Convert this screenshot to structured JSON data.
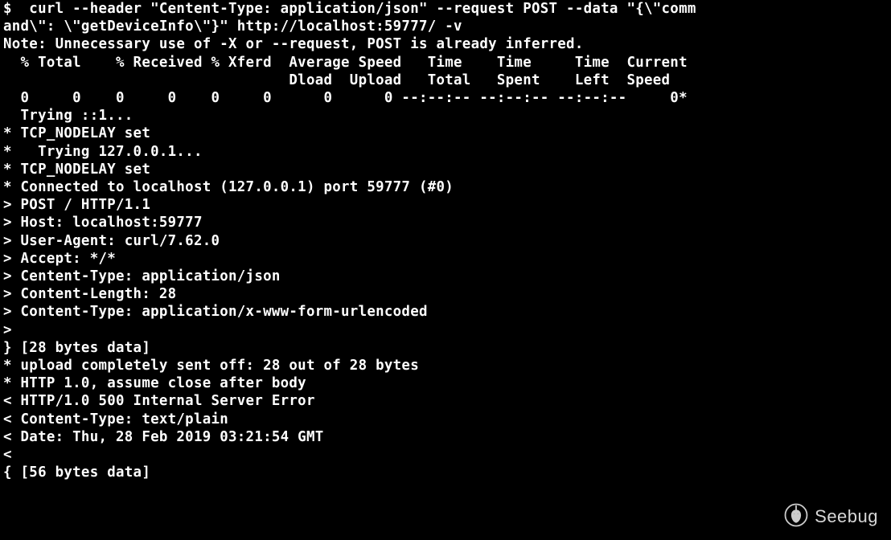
{
  "terminal": {
    "lines": [
      "$  curl --header \"Centent-Type: application/json\" --request POST --data \"{\\\"comm",
      "and\\\": \\\"getDeviceInfo\\\"}\" http://localhost:59777/ -v",
      "Note: Unnecessary use of -X or --request, POST is already inferred.",
      "  % Total    % Received % Xferd  Average Speed   Time    Time     Time  Current",
      "                                 Dload  Upload   Total   Spent    Left  Speed",
      "  0     0    0     0    0     0      0      0 --:--:-- --:--:-- --:--:--     0*",
      "  Trying ::1...",
      "* TCP_NODELAY set",
      "*   Trying 127.0.0.1...",
      "* TCP_NODELAY set",
      "* Connected to localhost (127.0.0.1) port 59777 (#0)",
      "> POST / HTTP/1.1",
      "> Host: localhost:59777",
      "> User-Agent: curl/7.62.0",
      "> Accept: */*",
      "> Centent-Type: application/json",
      "> Content-Length: 28",
      "> Content-Type: application/x-www-form-urlencoded",
      ">",
      "} [28 bytes data]",
      "* upload completely sent off: 28 out of 28 bytes",
      "* HTTP 1.0, assume close after body",
      "< HTTP/1.0 500 Internal Server Error",
      "< Content-Type: text/plain",
      "< Date: Thu, 28 Feb 2019 03:21:54 GMT",
      "<",
      "{ [56 bytes data]"
    ]
  },
  "watermark": {
    "label": "Seebug"
  }
}
